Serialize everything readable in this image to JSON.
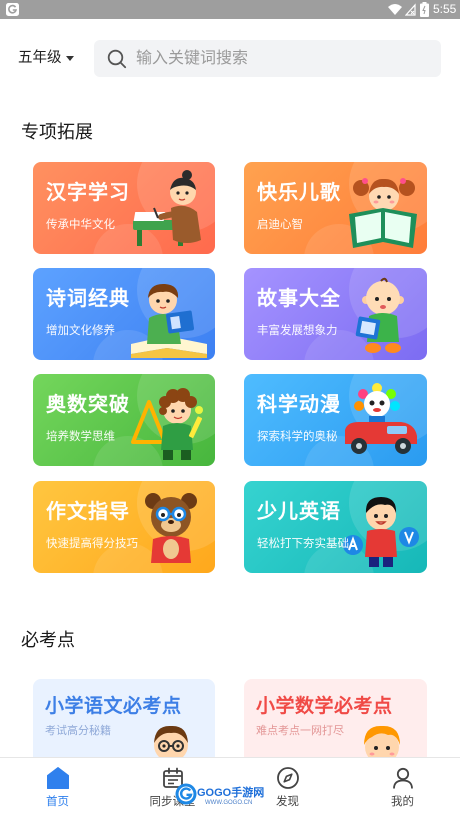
{
  "status_bar": {
    "time": "5:55"
  },
  "header": {
    "grade": "五年级",
    "search_placeholder": "输入关键词搜索"
  },
  "special": {
    "title": "专项拓展",
    "cards": [
      {
        "title": "汉字学习",
        "subtitle": "传承中华文化",
        "color_from": "#ff9160",
        "color_to": "#ff6a4d"
      },
      {
        "title": "快乐儿歌",
        "subtitle": "启迪心智",
        "color_from": "#ffa24f",
        "color_to": "#ff7d3a"
      },
      {
        "title": "诗词经典",
        "subtitle": "增加文化修养",
        "color_from": "#5da2ff",
        "color_to": "#3d80f2"
      },
      {
        "title": "故事大全",
        "subtitle": "丰富发展想象力",
        "color_from": "#a593ff",
        "color_to": "#7c6cf2"
      },
      {
        "title": "奥数突破",
        "subtitle": "培养数学思维",
        "color_from": "#74d65c",
        "color_to": "#47b63d"
      },
      {
        "title": "科学动漫",
        "subtitle": "探索科学的奥秘",
        "color_from": "#4fbcff",
        "color_to": "#2a9bf0"
      },
      {
        "title": "作文指导",
        "subtitle": "快速提高得分技巧",
        "color_from": "#ffc640",
        "color_to": "#ffa81c"
      },
      {
        "title": "少儿英语",
        "subtitle": "轻松打下夯实基础",
        "color_from": "#36d3d0",
        "color_to": "#16b8b8"
      }
    ]
  },
  "must": {
    "title": "必考点",
    "cards": [
      {
        "title": "小学语文必考点",
        "subtitle": "考试高分秘籍",
        "title_color": "#3d7fe6",
        "sub_color": "#8fa9d8",
        "bg": "#e9f2ff"
      },
      {
        "title": "小学数学必考点",
        "subtitle": "难点考点一网打尽",
        "title_color": "#f04a46",
        "sub_color": "#e39696",
        "bg": "#ffeded"
      }
    ]
  },
  "tabs": [
    {
      "label": "首页",
      "icon": "home-icon",
      "active": true
    },
    {
      "label": "同步课堂",
      "icon": "calendar-icon",
      "active": false
    },
    {
      "label": "发现",
      "icon": "compass-icon",
      "active": false
    },
    {
      "label": "我的",
      "icon": "user-icon",
      "active": false
    }
  ],
  "colors": {
    "accent": "#2f80ed",
    "tab_inactive": "#444444",
    "status_bar": "#9e9e9e",
    "search_bg": "#f2f3f5"
  },
  "watermark": {
    "brand": "GOGO手游网",
    "url": "WWW.GOGO.CN"
  }
}
